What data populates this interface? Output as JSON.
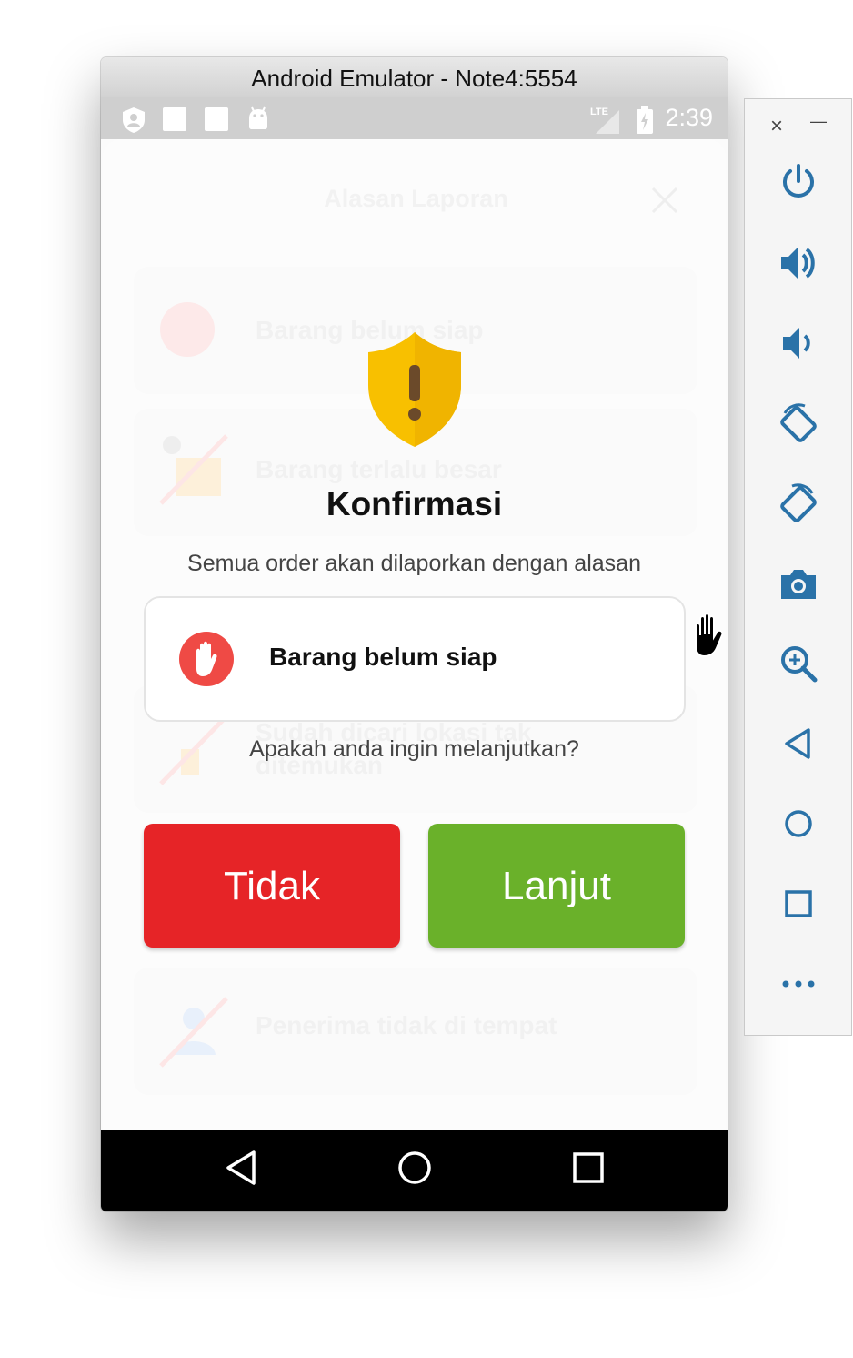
{
  "window": {
    "title": "Android Emulator - Note4:5554"
  },
  "status_bar": {
    "time": "2:39",
    "network": "LTE"
  },
  "background_sheet": {
    "title": "Alasan Laporan",
    "options": [
      "Barang belum siap",
      "Barang terlalu besar",
      "Sudah dicari lokasi tak ditemukan",
      "Penerima tidak di tempat"
    ]
  },
  "dialog": {
    "title": "Konfirmasi",
    "message": "Semua order akan dilaporkan dengan alasan",
    "reason": "Barang belum siap",
    "question": "Apakah anda ingin melanjutkan?",
    "cancel_label": "Tidak",
    "confirm_label": "Lanjut"
  },
  "colors": {
    "cancel": "#e62427",
    "confirm": "#6ab12a",
    "warning_shield": "#f8c000",
    "reason_icon": "#ef4a45"
  },
  "toolbar": {
    "close_label": "×",
    "minimize_label": "—",
    "buttons": [
      "power-icon",
      "volume-up-icon",
      "volume-down-icon",
      "rotate-left-icon",
      "rotate-right-icon",
      "camera-icon",
      "zoom-icon",
      "back-icon",
      "home-icon",
      "overview-icon",
      "more-icon"
    ]
  }
}
